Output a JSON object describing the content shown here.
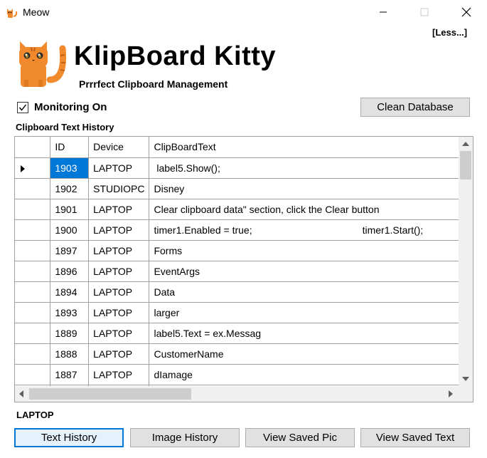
{
  "window": {
    "title": "Meow",
    "minimize_icon": "minimize-icon",
    "maximize_icon": "maximize-icon",
    "close_icon": "close-icon"
  },
  "header": {
    "less_link": "[Less...]",
    "app_title": "KlipBoard Kitty",
    "subtitle": "Prrrfect Clipboard Management",
    "logo_icon": "cat-icon"
  },
  "controls": {
    "monitoring_label": "Monitoring On",
    "monitoring_checked": true,
    "clean_button": "Clean Database"
  },
  "history": {
    "section_label": "Clipboard Text History",
    "columns": [
      "ID",
      "Device",
      "ClipBoardText"
    ],
    "rows": [
      {
        "id": "1903",
        "device": "LAPTOP",
        "text": " label5.Show();",
        "selected": true
      },
      {
        "id": "1902",
        "device": "STUDIOPC",
        "text": "Disney"
      },
      {
        "id": "1901",
        "device": "LAPTOP",
        "text": "Clear clipboard data\" section, click the Clear button"
      },
      {
        "id": "1900",
        "device": "LAPTOP",
        "text": "timer1.Enabled = true;",
        "text2": "timer1.Start();"
      },
      {
        "id": "1897",
        "device": "LAPTOP",
        "text": "Forms"
      },
      {
        "id": "1896",
        "device": "LAPTOP",
        "text": "EventArgs"
      },
      {
        "id": "1894",
        "device": "LAPTOP",
        "text": "Data"
      },
      {
        "id": "1893",
        "device": "LAPTOP",
        "text": "larger"
      },
      {
        "id": "1889",
        "device": "LAPTOP",
        "text": "label5.Text = ex.Messag"
      },
      {
        "id": "1888",
        "device": "LAPTOP",
        "text": "CustomerName"
      },
      {
        "id": "1887",
        "device": "LAPTOP",
        "text": "dIamage"
      },
      {
        "id": "",
        "device": "",
        "text": ""
      }
    ]
  },
  "footer": {
    "device_label": "LAPTOP",
    "text_history_button": "Text History",
    "image_history_button": "Image History",
    "view_saved_pic_button": "View Saved Pic",
    "view_saved_text_button": "View Saved Text"
  },
  "colors": {
    "accent": "#0078d7",
    "button_bg": "#e1e1e1",
    "cat_orange": "#f08a2c"
  }
}
